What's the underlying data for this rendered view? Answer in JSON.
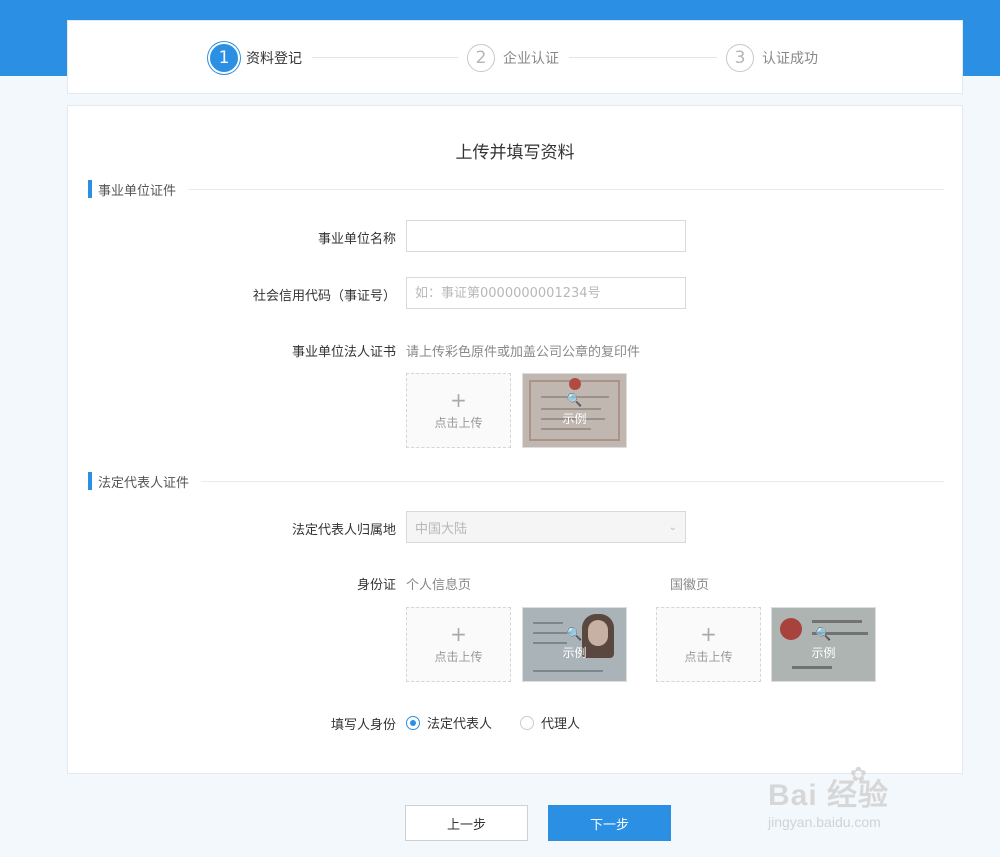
{
  "steps": [
    {
      "num": "1",
      "label": "资料登记"
    },
    {
      "num": "2",
      "label": "企业认证"
    },
    {
      "num": "3",
      "label": "认证成功"
    }
  ],
  "form": {
    "title": "上传并填写资料",
    "section1": "事业单位证件",
    "section2": "法定代表人证件",
    "org_name_label": "事业单位名称",
    "org_name_value": "",
    "credit_code_label": "社会信用代码（事证号）",
    "credit_code_placeholder": "如：事证第0000000001234号",
    "cert_label": "事业单位法人证书",
    "cert_hint": "请上传彩色原件或加盖公司公章的复印件",
    "region_label": "法定代表人归属地",
    "region_value": "中国大陆",
    "id_label": "身份证",
    "id_front_label": "个人信息页",
    "id_back_label": "国徽页",
    "filler_label": "填写人身份",
    "filler_options": [
      "法定代表人",
      "代理人"
    ],
    "filler_selected": "法定代表人"
  },
  "upload": {
    "plus": "+",
    "text": "点击上传"
  },
  "sample": {
    "text": "示例",
    "zoom_icon": "🔍"
  },
  "buttons": {
    "prev": "上一步",
    "next": "下一步"
  },
  "watermark": {
    "brand": "Bai   经验",
    "url": "jingyan.baidu.com"
  },
  "colors": {
    "accent": "#2b8fe3",
    "band": "#2b8fe3"
  }
}
